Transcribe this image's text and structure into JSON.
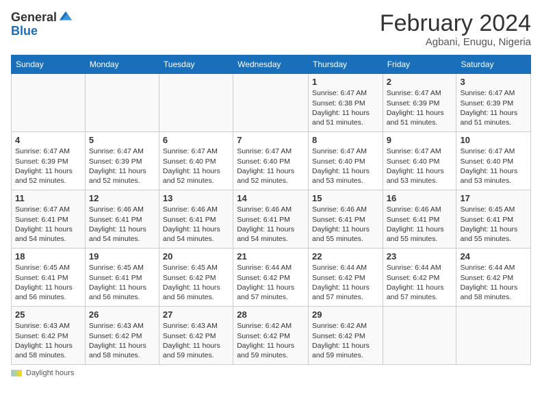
{
  "logo": {
    "general": "General",
    "blue": "Blue"
  },
  "title": {
    "month": "February 2024",
    "location": "Agbani, Enugu, Nigeria"
  },
  "days_header": [
    "Sunday",
    "Monday",
    "Tuesday",
    "Wednesday",
    "Thursday",
    "Friday",
    "Saturday"
  ],
  "weeks": [
    [
      {
        "day": "",
        "info": ""
      },
      {
        "day": "",
        "info": ""
      },
      {
        "day": "",
        "info": ""
      },
      {
        "day": "",
        "info": ""
      },
      {
        "day": "1",
        "info": "Sunrise: 6:47 AM\nSunset: 6:38 PM\nDaylight: 11 hours and 51 minutes."
      },
      {
        "day": "2",
        "info": "Sunrise: 6:47 AM\nSunset: 6:39 PM\nDaylight: 11 hours and 51 minutes."
      },
      {
        "day": "3",
        "info": "Sunrise: 6:47 AM\nSunset: 6:39 PM\nDaylight: 11 hours and 51 minutes."
      }
    ],
    [
      {
        "day": "4",
        "info": "Sunrise: 6:47 AM\nSunset: 6:39 PM\nDaylight: 11 hours and 52 minutes."
      },
      {
        "day": "5",
        "info": "Sunrise: 6:47 AM\nSunset: 6:39 PM\nDaylight: 11 hours and 52 minutes."
      },
      {
        "day": "6",
        "info": "Sunrise: 6:47 AM\nSunset: 6:40 PM\nDaylight: 11 hours and 52 minutes."
      },
      {
        "day": "7",
        "info": "Sunrise: 6:47 AM\nSunset: 6:40 PM\nDaylight: 11 hours and 52 minutes."
      },
      {
        "day": "8",
        "info": "Sunrise: 6:47 AM\nSunset: 6:40 PM\nDaylight: 11 hours and 53 minutes."
      },
      {
        "day": "9",
        "info": "Sunrise: 6:47 AM\nSunset: 6:40 PM\nDaylight: 11 hours and 53 minutes."
      },
      {
        "day": "10",
        "info": "Sunrise: 6:47 AM\nSunset: 6:40 PM\nDaylight: 11 hours and 53 minutes."
      }
    ],
    [
      {
        "day": "11",
        "info": "Sunrise: 6:47 AM\nSunset: 6:41 PM\nDaylight: 11 hours and 54 minutes."
      },
      {
        "day": "12",
        "info": "Sunrise: 6:46 AM\nSunset: 6:41 PM\nDaylight: 11 hours and 54 minutes."
      },
      {
        "day": "13",
        "info": "Sunrise: 6:46 AM\nSunset: 6:41 PM\nDaylight: 11 hours and 54 minutes."
      },
      {
        "day": "14",
        "info": "Sunrise: 6:46 AM\nSunset: 6:41 PM\nDaylight: 11 hours and 54 minutes."
      },
      {
        "day": "15",
        "info": "Sunrise: 6:46 AM\nSunset: 6:41 PM\nDaylight: 11 hours and 55 minutes."
      },
      {
        "day": "16",
        "info": "Sunrise: 6:46 AM\nSunset: 6:41 PM\nDaylight: 11 hours and 55 minutes."
      },
      {
        "day": "17",
        "info": "Sunrise: 6:45 AM\nSunset: 6:41 PM\nDaylight: 11 hours and 55 minutes."
      }
    ],
    [
      {
        "day": "18",
        "info": "Sunrise: 6:45 AM\nSunset: 6:41 PM\nDaylight: 11 hours and 56 minutes."
      },
      {
        "day": "19",
        "info": "Sunrise: 6:45 AM\nSunset: 6:41 PM\nDaylight: 11 hours and 56 minutes."
      },
      {
        "day": "20",
        "info": "Sunrise: 6:45 AM\nSunset: 6:42 PM\nDaylight: 11 hours and 56 minutes."
      },
      {
        "day": "21",
        "info": "Sunrise: 6:44 AM\nSunset: 6:42 PM\nDaylight: 11 hours and 57 minutes."
      },
      {
        "day": "22",
        "info": "Sunrise: 6:44 AM\nSunset: 6:42 PM\nDaylight: 11 hours and 57 minutes."
      },
      {
        "day": "23",
        "info": "Sunrise: 6:44 AM\nSunset: 6:42 PM\nDaylight: 11 hours and 57 minutes."
      },
      {
        "day": "24",
        "info": "Sunrise: 6:44 AM\nSunset: 6:42 PM\nDaylight: 11 hours and 58 minutes."
      }
    ],
    [
      {
        "day": "25",
        "info": "Sunrise: 6:43 AM\nSunset: 6:42 PM\nDaylight: 11 hours and 58 minutes."
      },
      {
        "day": "26",
        "info": "Sunrise: 6:43 AM\nSunset: 6:42 PM\nDaylight: 11 hours and 58 minutes."
      },
      {
        "day": "27",
        "info": "Sunrise: 6:43 AM\nSunset: 6:42 PM\nDaylight: 11 hours and 59 minutes."
      },
      {
        "day": "28",
        "info": "Sunrise: 6:42 AM\nSunset: 6:42 PM\nDaylight: 11 hours and 59 minutes."
      },
      {
        "day": "29",
        "info": "Sunrise: 6:42 AM\nSunset: 6:42 PM\nDaylight: 11 hours and 59 minutes."
      },
      {
        "day": "",
        "info": ""
      },
      {
        "day": "",
        "info": ""
      }
    ]
  ],
  "footer": {
    "daylight_label": "Daylight hours"
  }
}
